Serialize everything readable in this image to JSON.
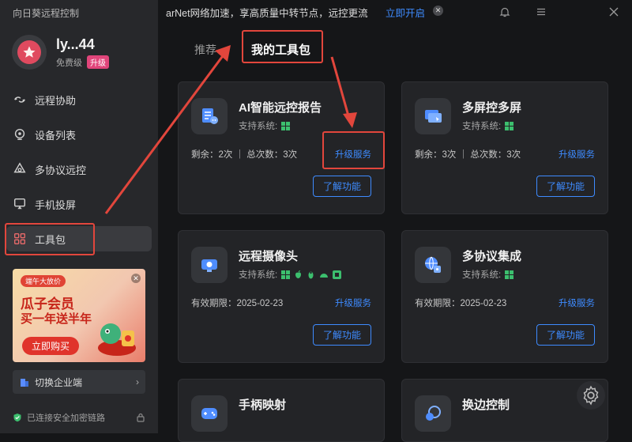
{
  "app": {
    "title": "向日葵远程控制"
  },
  "user": {
    "name": "ly...44",
    "tier": "免费级",
    "upgrade_badge": "升级"
  },
  "nav": {
    "items": [
      {
        "label": "远程协助",
        "icon": "remote-assist-icon"
      },
      {
        "label": "设备列表",
        "icon": "device-list-icon"
      },
      {
        "label": "多协议远控",
        "icon": "multi-protocol-icon"
      },
      {
        "label": "手机投屏",
        "icon": "phone-cast-icon"
      },
      {
        "label": "工具包",
        "icon": "toolkit-icon",
        "active": true
      }
    ]
  },
  "promo": {
    "tag": "端午大放价",
    "line1": "瓜子会员",
    "line2": "买一年送半年",
    "button": "立即购买"
  },
  "switch_enterprise": {
    "label": "切换企业端"
  },
  "secure_status": {
    "label": "已连接安全加密链路"
  },
  "banner": {
    "text": "arNet网络加速，享高质量中转节点，远控更流",
    "link": "立即开启"
  },
  "tabs": {
    "recommended": "推荐",
    "my_toolkit": "我的工具包"
  },
  "cards": [
    {
      "title": "AI智能远控报告",
      "system_label": "支持系统:",
      "quota": "剩余：2次 ｜ 总次数：3次",
      "upgrade": "升级服务",
      "learn": "了解功能",
      "icon": "ai-report-icon",
      "os": [
        "windows"
      ]
    },
    {
      "title": "多屏控多屏",
      "system_label": "支持系统:",
      "quota": "剩余：3次 ｜ 总次数：3次",
      "upgrade": "升级服务",
      "learn": "了解功能",
      "icon": "multi-screen-icon",
      "os": [
        "windows"
      ]
    },
    {
      "title": "远程摄像头",
      "system_label": "支持系统:",
      "quota": "有效期限：2025-02-23",
      "upgrade": "升级服务",
      "learn": "了解功能",
      "icon": "camera-icon",
      "os": [
        "windows",
        "apple",
        "linux",
        "android",
        "other"
      ]
    },
    {
      "title": "多协议集成",
      "system_label": "支持系统:",
      "quota": "有效期限：2025-02-23",
      "upgrade": "升级服务",
      "learn": "了解功能",
      "icon": "protocol-integration-icon",
      "os": [
        "windows"
      ]
    },
    {
      "title": "手柄映射",
      "icon": "gamepad-icon"
    },
    {
      "title": "换边控制",
      "icon": "switch-side-icon"
    }
  ],
  "colors": {
    "accent": "#3e8bff",
    "highlight": "#e2463c",
    "badge": "#e0457a"
  }
}
